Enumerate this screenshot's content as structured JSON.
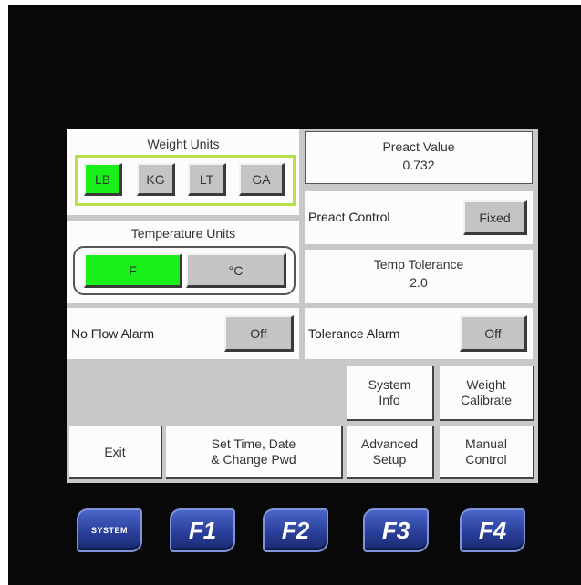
{
  "weight_units": {
    "title": "Weight Units",
    "options": [
      "LB",
      "KG",
      "LT",
      "GA"
    ],
    "selected": "LB"
  },
  "temperature_units": {
    "title": "Temperature Units",
    "options": [
      "F",
      "°C"
    ],
    "selected": "F"
  },
  "preact_value": {
    "title": "Preact Value",
    "value": "0.732"
  },
  "preact_control": {
    "label": "Preact Control",
    "button": "Fixed"
  },
  "temp_tolerance": {
    "title": "Temp Tolerance",
    "value": "2.0"
  },
  "no_flow_alarm": {
    "label": "No Flow Alarm",
    "button": "Off"
  },
  "tolerance_alarm": {
    "label": "Tolerance Alarm",
    "button": "Off"
  },
  "menu": {
    "system_info": "System\nInfo",
    "weight_calibrate": "Weight\nCalibrate",
    "exit": "Exit",
    "set_time": "Set Time, Date\n& Change Pwd",
    "advanced_setup": "Advanced\nSetup",
    "manual_control": "Manual\nControl"
  },
  "function_keys": [
    "SYSTEM",
    "F1",
    "F2",
    "F3",
    "F4"
  ],
  "colors": {
    "bezel": "#080808",
    "screen_bg": "#c8c8c8",
    "selected_green": "#19f019",
    "weight_border": "#b6e04a",
    "fkey_blue": "#2a3f9a"
  }
}
